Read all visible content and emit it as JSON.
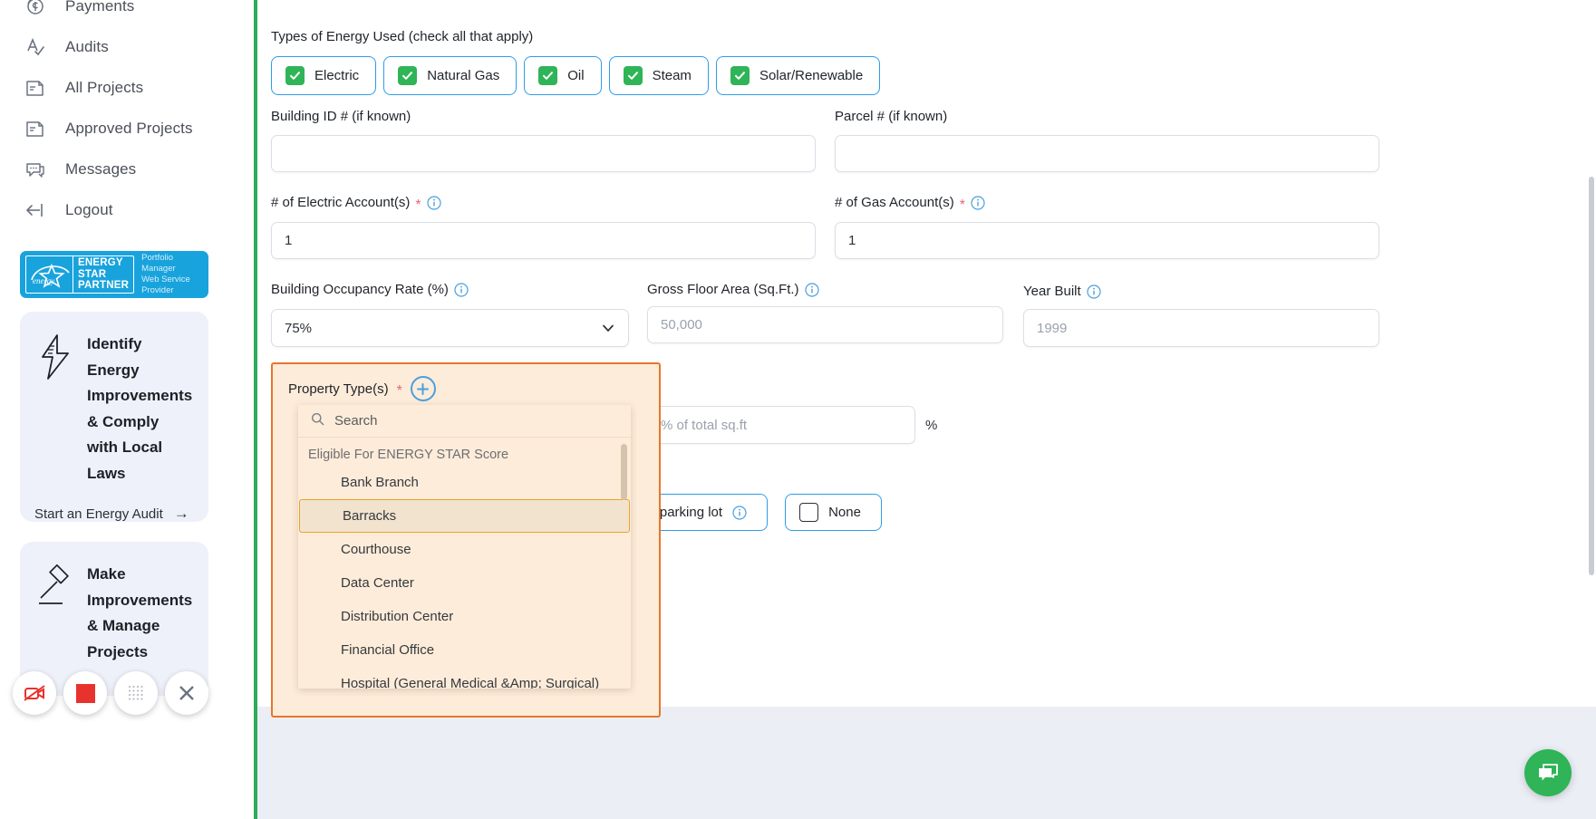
{
  "sidebar": {
    "nav_items": [
      {
        "label": "Payments",
        "icon": "payments-icon"
      },
      {
        "label": "Audits",
        "icon": "audits-icon"
      },
      {
        "label": "All Projects",
        "icon": "projects-icon"
      },
      {
        "label": "Approved Projects",
        "icon": "approved-projects-icon"
      },
      {
        "label": "Messages",
        "icon": "messages-icon"
      },
      {
        "label": "Logout",
        "icon": "logout-icon"
      }
    ],
    "badge": {
      "words": "ENERGY\nSTAR\nPARTNER",
      "line1": "ENERGY",
      "line2": "STAR",
      "line3": "PARTNER",
      "tagline_1": "Portfolio Manager",
      "tagline_2": "Web Service Provider",
      "star_word": "energy",
      "bg_color": "#19a3dd"
    },
    "promos": [
      {
        "icon": "lightning-bolt-icon",
        "title": "Identify Energy Improvements & Comply with Local Laws",
        "cta": "Start an Energy Audit",
        "cta_arrow": "→"
      },
      {
        "icon": "gavel-icon",
        "title": "Make Improvements & Manage Projects",
        "cta": "",
        "cta_arrow": ""
      }
    ],
    "recorder_buttons": [
      {
        "name": "camera-off-icon",
        "color": "#e8322c"
      },
      {
        "name": "stop-recording-icon",
        "color": "#e8322c"
      },
      {
        "name": "dots-grid-icon",
        "color": "#b9bcc4"
      },
      {
        "name": "close-icon",
        "color": "#6b7280"
      }
    ]
  },
  "form": {
    "energy_types": {
      "label": "Types of Energy Used (check all that apply)",
      "options": [
        {
          "label": "Electric",
          "checked": true
        },
        {
          "label": "Natural Gas",
          "checked": true
        },
        {
          "label": "Oil",
          "checked": true
        },
        {
          "label": "Steam",
          "checked": true
        },
        {
          "label": "Solar/Renewable",
          "checked": true
        }
      ]
    },
    "building_id": {
      "label": "Building ID # (if known)",
      "value": "",
      "placeholder": ""
    },
    "parcel": {
      "label": "Parcel # (if known)",
      "value": "",
      "placeholder": ""
    },
    "electric_accounts": {
      "label": "# of Electric Account(s)",
      "value": "1",
      "required": true,
      "has_info": true
    },
    "gas_accounts": {
      "label": "# of Gas Account(s)",
      "value": "1",
      "required": true,
      "has_info": true
    },
    "occupancy": {
      "label": "Building Occupancy Rate (%)",
      "value": "75%",
      "has_info": true
    },
    "gross_floor_area": {
      "label": "Gross Floor Area (Sq.Ft.)",
      "value": "50,000",
      "has_info": true
    },
    "year_built": {
      "label": "Year Built",
      "value": "1999",
      "has_info": true
    },
    "property_types": {
      "label": "Property Type(s)",
      "required": true,
      "add_button": "+",
      "percent_placeholder": "% of total sq.ft",
      "percent_sign": "%",
      "dropdown": {
        "search_placeholder": "Search",
        "group_header": "Eligible For ENERGY STAR Score",
        "items": [
          {
            "label": "Bank Branch",
            "selected": false
          },
          {
            "label": "Barracks",
            "selected": true
          },
          {
            "label": "Courthouse",
            "selected": false
          },
          {
            "label": "Data Center",
            "selected": false
          },
          {
            "label": "Distribution Center",
            "selected": false
          },
          {
            "label": "Financial Office",
            "selected": false
          },
          {
            "label": "Hospital (General Medical &Amp; Surgical)",
            "selected": false
          }
        ]
      }
    },
    "parking": {
      "options": [
        {
          "label": "Open parking lot",
          "checked": false,
          "has_info": true
        },
        {
          "label": "None",
          "checked": false,
          "has_info": false
        }
      ]
    }
  },
  "chat": {
    "icon": "chat-bubble-icon",
    "color": "#2fb457"
  },
  "colors": {
    "accent_blue": "#2f9ce8",
    "accent_green": "#2fb457",
    "highlight_orange": "#e8762a",
    "highlight_bg": "#fdecd9",
    "required_red": "#e8657a"
  }
}
